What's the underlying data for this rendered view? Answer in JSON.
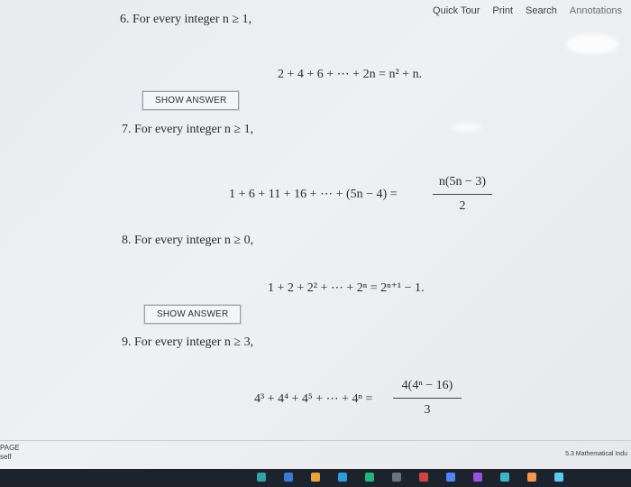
{
  "toolbar": {
    "quick_tour": "Quick Tour",
    "print": "Print",
    "search": "Search",
    "annotations": "Annotations"
  },
  "problems": [
    {
      "label": "6. For every integer n ≥ 1,",
      "equation": "2 + 4 + 6 + ⋯ + 2n = n² + n.",
      "button": "SHOW ANSWER"
    },
    {
      "label": "7. For every integer n ≥ 1,",
      "equation_lhs": "1 + 6 + 11 + 16 + ⋯ + (5n − 4) =",
      "numerator": "n(5n − 3)",
      "denominator": "2"
    },
    {
      "label": "8. For every integer n ≥ 0,",
      "equation": "1 + 2 + 2² + ⋯ + 2ⁿ = 2ⁿ⁺¹ − 1.",
      "button": "SHOW ANSWER"
    },
    {
      "label": "9. For every integer n ≥ 3,",
      "equation_lhs": "4³ + 4⁴ + 4⁵ + ⋯ + 4ⁿ =",
      "numerator": "4(4ⁿ − 16)",
      "denominator": "3"
    }
  ],
  "footer": {
    "left_line1": "PAGE",
    "left_line2": "self",
    "right_text": "5.3 Mathematical Indu"
  },
  "taskbar_colors": [
    "#2fa3a0",
    "#3a7bd5",
    "#e8a33d",
    "#2d9cdb",
    "#24b47e",
    "#6b7280",
    "#d14343",
    "#4f86f7",
    "#9b51e0",
    "#3fb6c4",
    "#f2994a",
    "#56ccf2"
  ]
}
